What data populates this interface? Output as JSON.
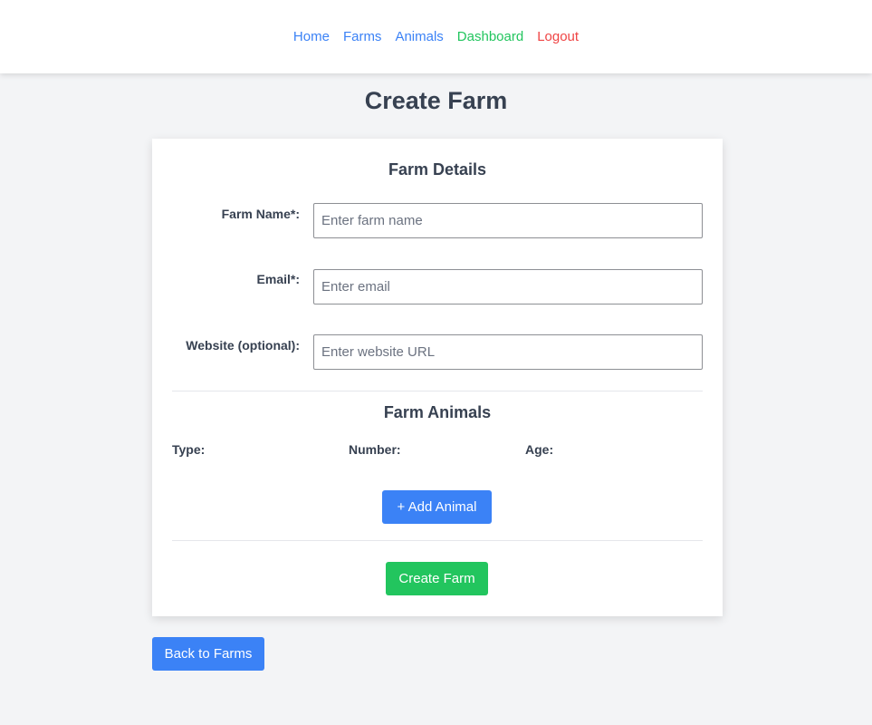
{
  "nav": {
    "links": [
      {
        "label": "Home",
        "color": "#3b82f6"
      },
      {
        "label": "Farms",
        "color": "#3b82f6"
      },
      {
        "label": "Animals",
        "color": "#3b82f6"
      },
      {
        "label": "Dashboard",
        "color": "#22c55e"
      },
      {
        "label": "Logout",
        "color": "#ef4444"
      }
    ]
  },
  "page": {
    "title": "Create Farm"
  },
  "form": {
    "details_title": "Farm Details",
    "fields": {
      "farm_name": {
        "label": "Farm Name*:",
        "placeholder": "Enter farm name",
        "value": ""
      },
      "email": {
        "label": "Email*:",
        "placeholder": "Enter email",
        "value": ""
      },
      "website": {
        "label": "Website (optional):",
        "placeholder": "Enter website URL",
        "value": ""
      }
    },
    "animals_title": "Farm Animals",
    "animal_columns": [
      "Type:",
      "Number:",
      "Age:"
    ],
    "add_animal_label": "+ Add Animal",
    "submit_label": "Create Farm"
  },
  "back_label": "Back to Farms",
  "colors": {
    "primary": "#3b82f6",
    "success": "#22c55e",
    "danger": "#ef4444",
    "background": "#f3f4f6",
    "text": "#374151"
  }
}
